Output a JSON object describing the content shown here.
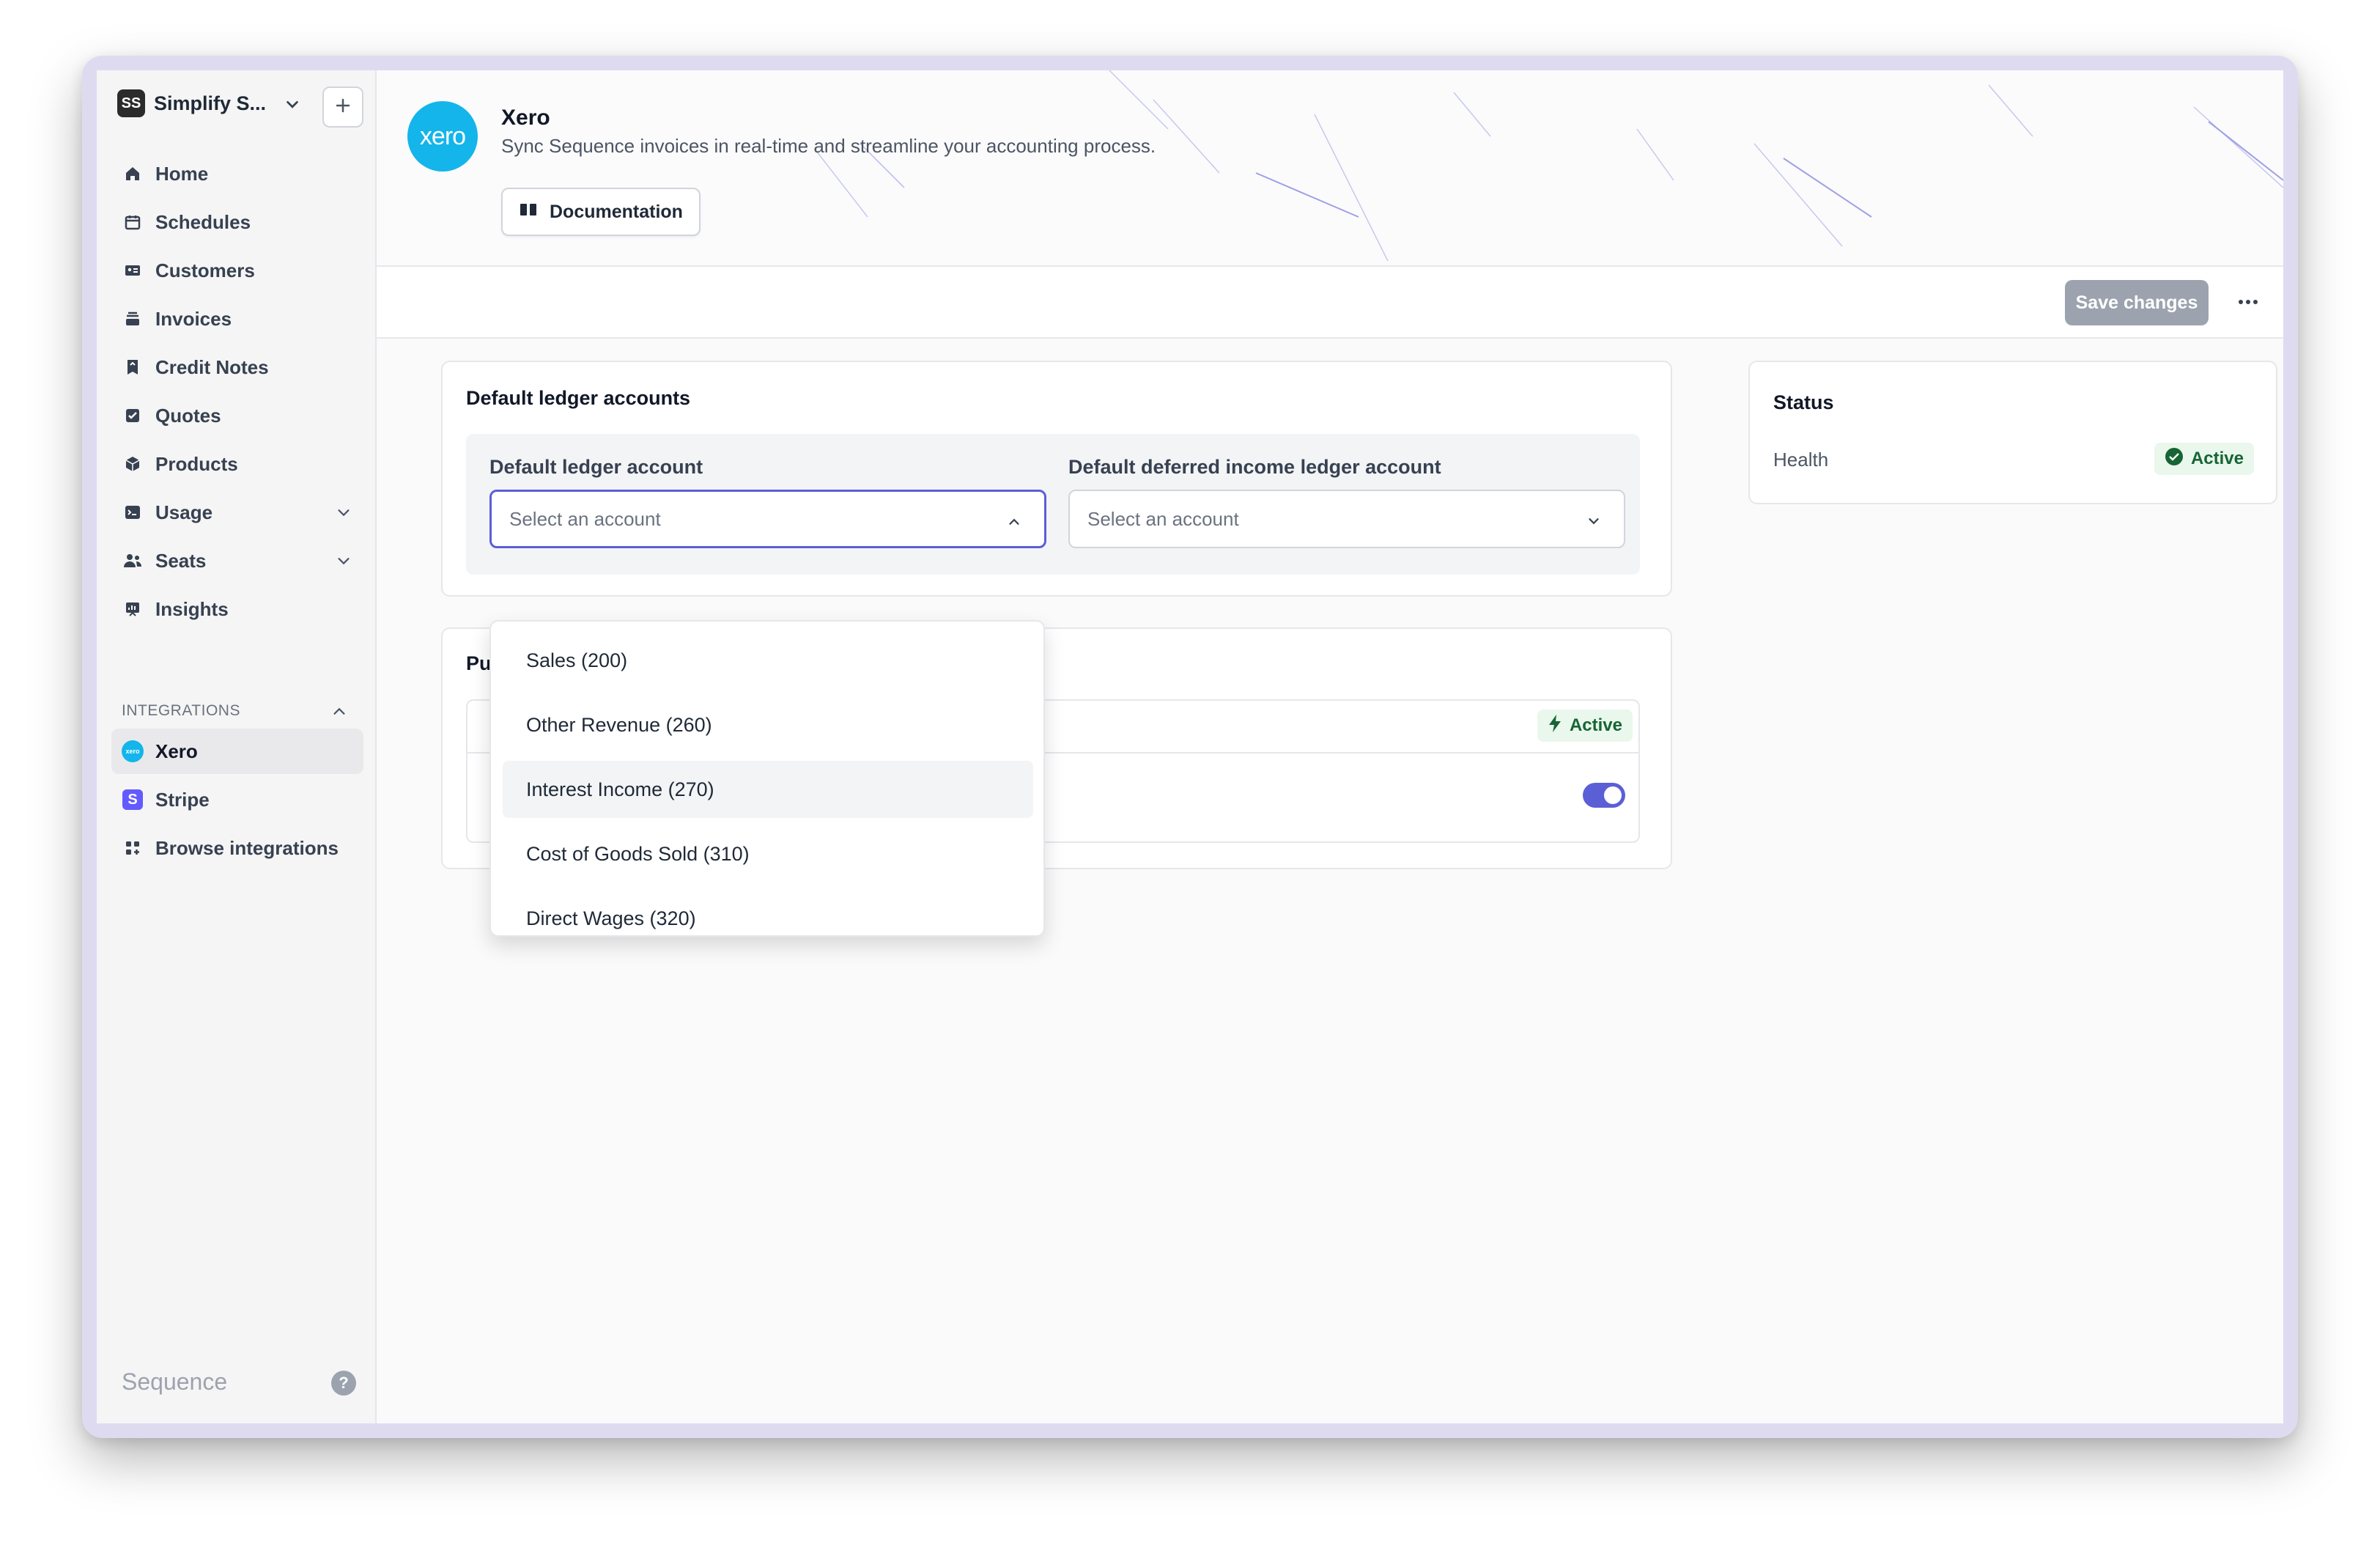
{
  "sidebar": {
    "org": {
      "initials": "SS",
      "name": "Simplify S..."
    },
    "nav": [
      {
        "label": "Home",
        "icon": "home-icon"
      },
      {
        "label": "Schedules",
        "icon": "calendar-icon"
      },
      {
        "label": "Customers",
        "icon": "id-card-icon"
      },
      {
        "label": "Invoices",
        "icon": "invoice-stack-icon"
      },
      {
        "label": "Credit Notes",
        "icon": "credit-note-icon"
      },
      {
        "label": "Quotes",
        "icon": "quote-check-icon"
      },
      {
        "label": "Products",
        "icon": "cube-icon"
      },
      {
        "label": "Usage",
        "icon": "terminal-icon"
      },
      {
        "label": "Seats",
        "icon": "users-icon"
      },
      {
        "label": "Insights",
        "icon": "chart-board-icon"
      }
    ],
    "integrations_label": "INTEGRATIONS",
    "integrations": [
      {
        "label": "Xero",
        "icon": "xero-icon",
        "badge": "xero"
      },
      {
        "label": "Stripe",
        "icon": "stripe-icon",
        "badge": "S"
      },
      {
        "label": "Browse integrations",
        "icon": "grid-plus-icon"
      }
    ],
    "brand": "Sequence",
    "help_glyph": "?"
  },
  "header": {
    "logo_text": "xero",
    "title": "Xero",
    "description": "Sync Sequence invoices in real-time and streamline your accounting process.",
    "doc_button": "Documentation"
  },
  "toolbar": {
    "save_label": "Save changes"
  },
  "ledger": {
    "title": "Default ledger accounts",
    "field1_label": "Default ledger account",
    "field1_placeholder": "Select an account",
    "field2_label": "Default deferred income ledger account",
    "field2_placeholder": "Select an account"
  },
  "dropdown": {
    "options": [
      "Sales (200)",
      "Other Revenue (260)",
      "Interest Income (270)",
      "Cost of Goods Sold (310)",
      "Direct Wages (320)"
    ],
    "highlighted_index": 2
  },
  "publish": {
    "title_visible": "Pu",
    "badge": "Active",
    "toggle_on": true
  },
  "status": {
    "title": "Status",
    "health_label": "Health",
    "health_value": "Active"
  },
  "colors": {
    "accent": "#5b5fd6",
    "xero": "#13b5ea",
    "stripe": "#635bff",
    "active_green": "#166534"
  }
}
